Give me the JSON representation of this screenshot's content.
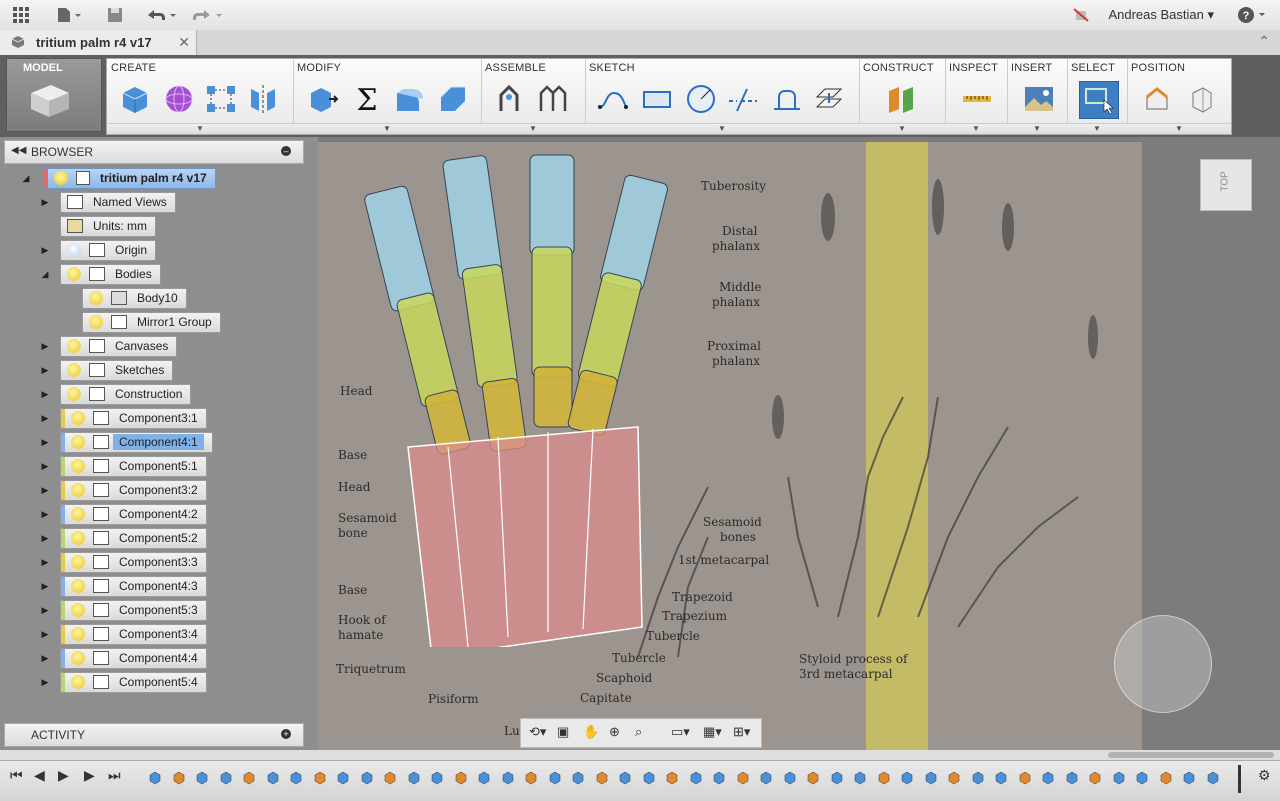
{
  "app": {
    "user_name": "Andreas Bastian",
    "document_title": "tritium palm r4 v17"
  },
  "ribbon": {
    "workspace": "MODEL",
    "groups": [
      {
        "label": "CREATE",
        "tools": [
          "box-icon",
          "sphere-icon",
          "pattern-icon",
          "mirror-icon"
        ]
      },
      {
        "label": "MODIFY",
        "tools": [
          "press-pull-icon",
          "sum-icon",
          "fillet-icon",
          "chamfer-icon"
        ]
      },
      {
        "label": "ASSEMBLE",
        "tools": [
          "joint-icon",
          "as-built-joint-icon"
        ]
      },
      {
        "label": "SKETCH",
        "tools": [
          "spline-icon",
          "rectangle-icon",
          "circle-icon",
          "trim-icon",
          "offset-icon",
          "project-icon"
        ]
      },
      {
        "label": "CONSTRUCT",
        "tools": [
          "plane-icon"
        ]
      },
      {
        "label": "INSPECT",
        "tools": [
          "measure-icon"
        ]
      },
      {
        "label": "INSERT",
        "tools": [
          "insert-image-icon"
        ]
      },
      {
        "label": "SELECT",
        "tools": [
          "window-select-icon"
        ]
      },
      {
        "label": "POSITION",
        "tools": [
          "capture-position-icon",
          "revert-icon"
        ]
      }
    ]
  },
  "browser": {
    "title": "BROWSER",
    "activity_label": "ACTIVITY",
    "root": "tritium palm r4 v17",
    "items": [
      {
        "label": "Named Views"
      },
      {
        "label": "Units: mm"
      },
      {
        "label": "Origin"
      },
      {
        "label": "Bodies"
      },
      {
        "label": "Body10"
      },
      {
        "label": "Mirror1 Group"
      },
      {
        "label": "Canvases"
      },
      {
        "label": "Sketches"
      },
      {
        "label": "Construction"
      },
      {
        "label": "Component3:1",
        "color": "#e6c84a"
      },
      {
        "label": "Component4:1",
        "color": "#7fb0e8",
        "selected": true
      },
      {
        "label": "Component5:1",
        "color": "#b6d86a"
      },
      {
        "label": "Component3:2",
        "color": "#e6c84a"
      },
      {
        "label": "Component4:2",
        "color": "#7fb0e8"
      },
      {
        "label": "Component5:2",
        "color": "#b6d86a"
      },
      {
        "label": "Component3:3",
        "color": "#e6c84a"
      },
      {
        "label": "Component4:3",
        "color": "#7fb0e8"
      },
      {
        "label": "Component5:3",
        "color": "#b6d86a"
      },
      {
        "label": "Component3:4",
        "color": "#e6c84a"
      },
      {
        "label": "Component4:4",
        "color": "#7fb0e8"
      },
      {
        "label": "Component5:4",
        "color": "#b6d86a"
      }
    ]
  },
  "canvas": {
    "viewcube_label": "TOP",
    "annotations": {
      "tuberosity": "Tuberosity",
      "distal_1": "Distal",
      "distal_2": "phalanx",
      "middle_1": "Middle",
      "middle_2": "phalanx",
      "proximal_1": "Proximal",
      "proximal_2": "phalanx",
      "head_1": "Head",
      "base_1": "Base",
      "head_2": "Head",
      "sesamoid_1": "Sesamoid",
      "sesamoid_2": "bone",
      "base_2": "Base",
      "hook_1": "Hook of",
      "hook_2": "hamate",
      "triquetrum": "Triquetrum",
      "pisiform": "Pisiform",
      "lunate": "Lun",
      "capitate": "Capitate",
      "scaphoid": "Scaphoid",
      "tubercle_1": "Tubercle",
      "tubercle_2": "Tubercle",
      "trapezium": "Trapezium",
      "trapezoid": "Trapezoid",
      "first_metacarpal": "1st metacarpal",
      "sesamoid_bones_1": "Sesamoid",
      "sesamoid_bones_2": "bones",
      "styloid_1": "Styloid process of",
      "styloid_2": "3rd metacarpal"
    }
  },
  "colors": {
    "accent_blue": "#3d7fc2",
    "selection": "#7fb0e8",
    "panel_bg": "#8e8e8e"
  }
}
